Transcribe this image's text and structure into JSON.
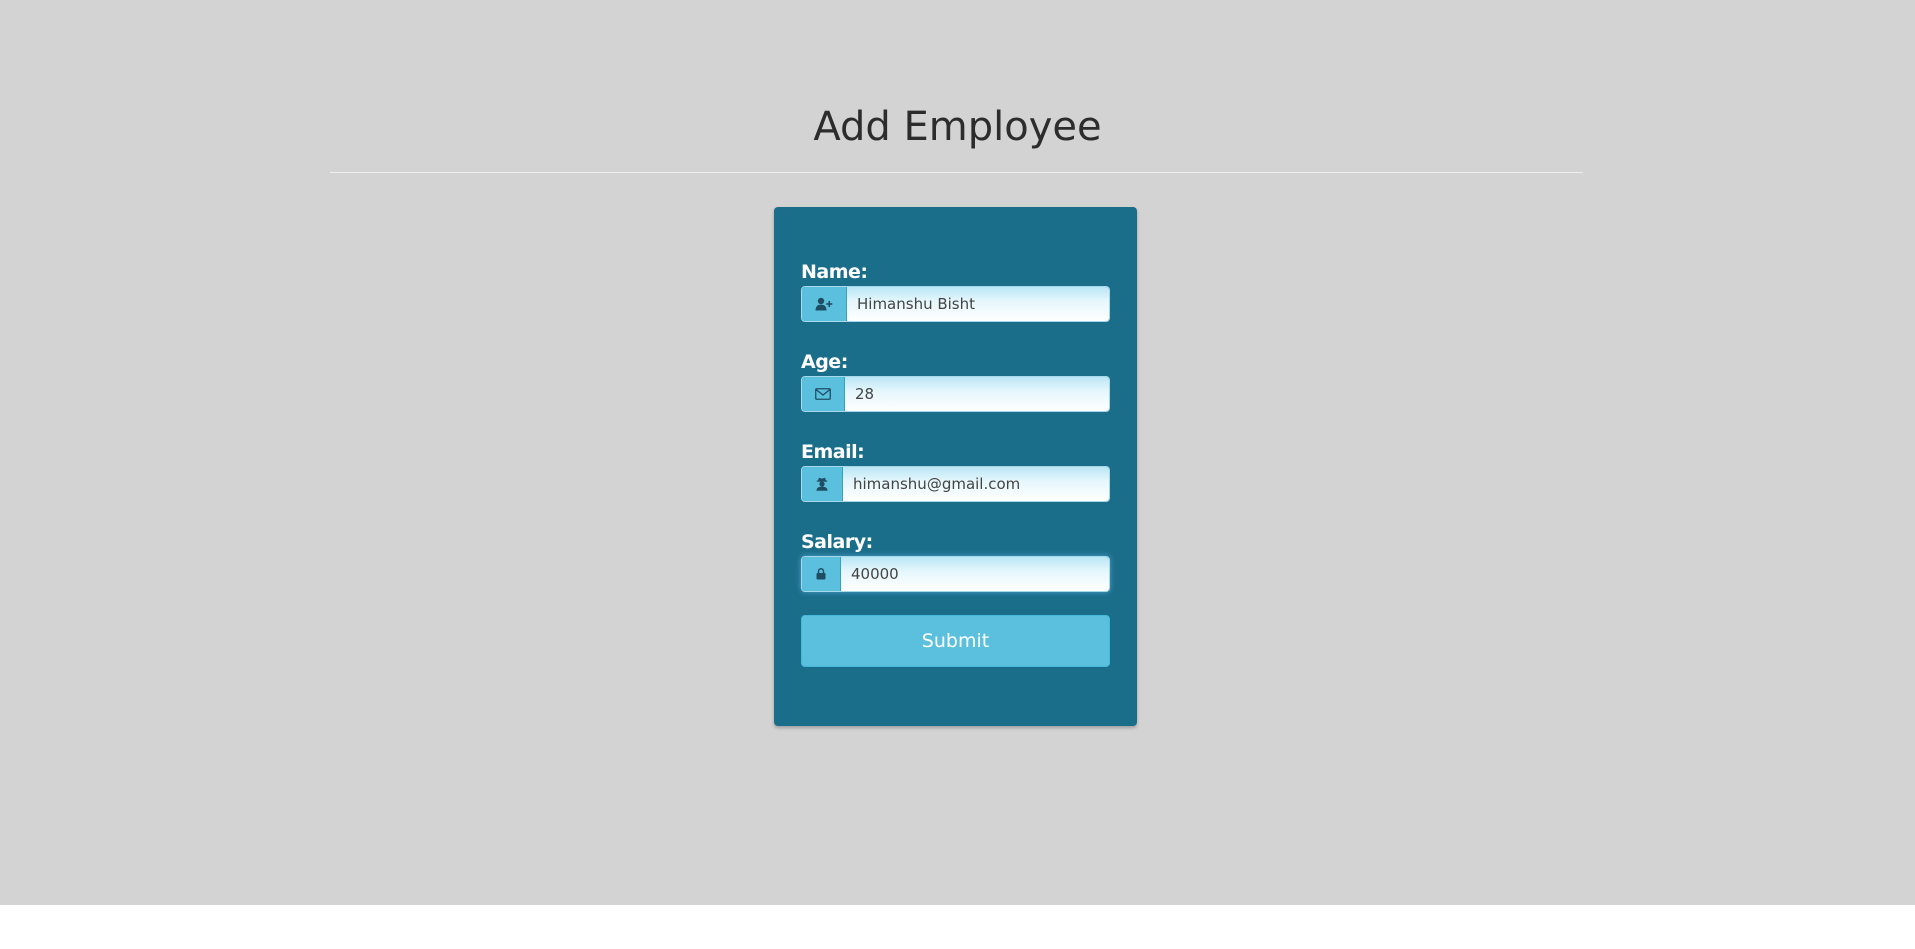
{
  "page": {
    "title": "Add Employee"
  },
  "form": {
    "fields": [
      {
        "label": "Name:",
        "value": "Himanshu Bisht",
        "icon": "user-plus-icon"
      },
      {
        "label": "Age:",
        "value": "28",
        "icon": "envelope-icon"
      },
      {
        "label": "Email:",
        "value": "himanshu@gmail.com",
        "icon": "user-secret-icon"
      },
      {
        "label": "Salary:",
        "value": "40000",
        "icon": "lock-icon"
      }
    ],
    "submit_label": "Submit"
  },
  "colors": {
    "background": "#d3d3d3",
    "card": "#1b6e8a",
    "accent": "#5bc0de",
    "title": "#2c2c2c"
  }
}
